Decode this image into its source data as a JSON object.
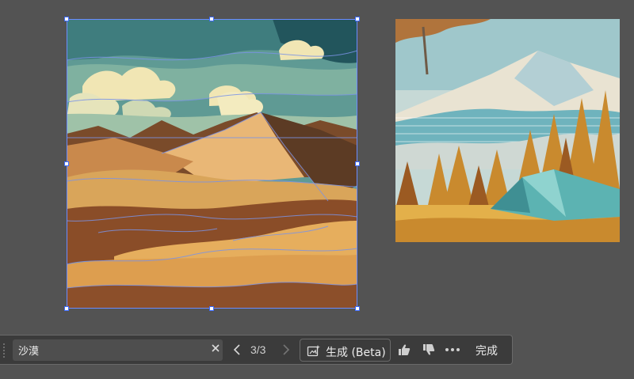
{
  "canvas": {
    "background": "#535353",
    "selection_color": "#6b8cff",
    "artworks": [
      {
        "name": "desert-artwork",
        "selected": true
      },
      {
        "name": "camping-artwork",
        "selected": false
      }
    ]
  },
  "taskbar": {
    "prompt_value": "沙漠",
    "clear_icon": "close-icon",
    "prev_icon": "chevron-left-icon",
    "pager": "3/3",
    "next_icon": "chevron-right-icon",
    "generate_icon": "generate-image-icon",
    "generate_label": "生成 (Beta)",
    "like_icon": "thumbs-up-icon",
    "dislike_icon": "thumbs-down-icon",
    "more_icon": "more-options-icon",
    "done_label": "完成"
  }
}
